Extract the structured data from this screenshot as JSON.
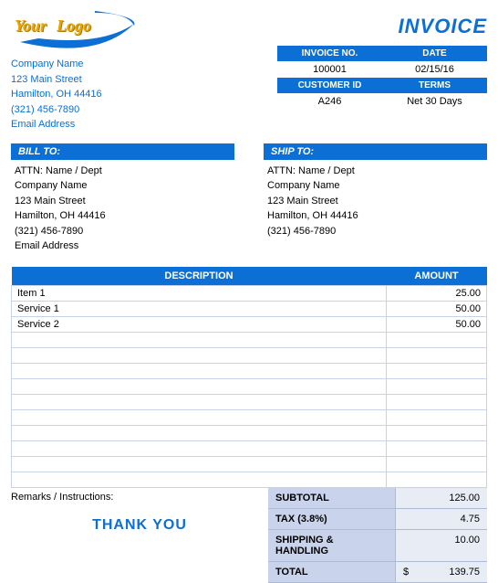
{
  "page_title": "INVOICE",
  "logo": {
    "your": "Your",
    "logo": "Logo"
  },
  "company": {
    "name": "Company Name",
    "street": "123 Main Street",
    "citystate": "Hamilton, OH  44416",
    "phone": "(321) 456-7890",
    "email": "Email Address"
  },
  "meta": {
    "invoice_no_label": "INVOICE NO.",
    "invoice_no": "100001",
    "date_label": "DATE",
    "date": "02/15/16",
    "customer_id_label": "CUSTOMER ID",
    "customer_id": "A246",
    "terms_label": "TERMS",
    "terms": "Net 30 Days"
  },
  "bill_to": {
    "header": "BILL TO:",
    "attn": "ATTN: Name / Dept",
    "name": "Company Name",
    "street": "123 Main Street",
    "citystate": "Hamilton, OH  44416",
    "phone": "(321) 456-7890",
    "email": "Email Address"
  },
  "ship_to": {
    "header": "SHIP TO:",
    "attn": "ATTN: Name / Dept",
    "name": "Company Name",
    "street": "123 Main Street",
    "citystate": "Hamilton, OH  44416",
    "phone": "(321) 456-7890"
  },
  "items_header": {
    "desc": "DESCRIPTION",
    "amt": "AMOUNT"
  },
  "items": [
    {
      "desc": "Item 1",
      "amt": "25.00"
    },
    {
      "desc": "Service 1",
      "amt": "50.00"
    },
    {
      "desc": "Service 2",
      "amt": "50.00"
    },
    {
      "desc": "",
      "amt": ""
    },
    {
      "desc": "",
      "amt": ""
    },
    {
      "desc": "",
      "amt": ""
    },
    {
      "desc": "",
      "amt": ""
    },
    {
      "desc": "",
      "amt": ""
    },
    {
      "desc": "",
      "amt": ""
    },
    {
      "desc": "",
      "amt": ""
    },
    {
      "desc": "",
      "amt": ""
    },
    {
      "desc": "",
      "amt": ""
    },
    {
      "desc": "",
      "amt": ""
    }
  ],
  "remarks_label": "Remarks / Instructions:",
  "totals": {
    "subtotal_label": "SUBTOTAL",
    "subtotal": "125.00",
    "tax_label": "TAX (3.8%)",
    "tax": "4.75",
    "shipping_label": "SHIPPING & HANDLING",
    "shipping": "10.00",
    "total_label": "TOTAL",
    "currency": "$",
    "total": "139.75"
  },
  "thankyou": "THANK YOU"
}
